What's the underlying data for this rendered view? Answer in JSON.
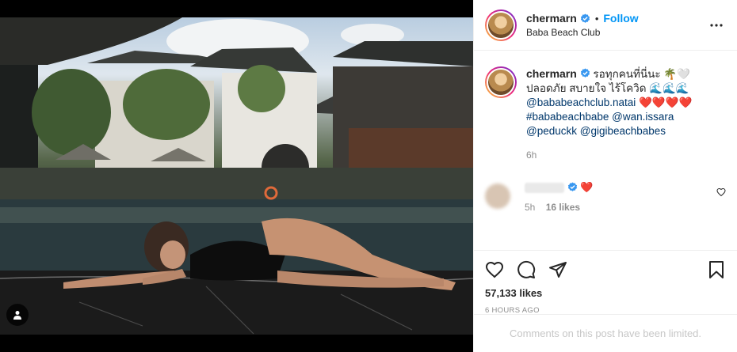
{
  "post": {
    "username": "chermarn",
    "follow_label": "Follow",
    "dot": "•",
    "location": "Baba Beach Club",
    "caption_line1": "รอทุกคนที่นี่นะ 🌴🤍",
    "caption_line2": "ปลอดภัย สบายใจ ไร้โควิด 🌊🌊🌊",
    "mention1": "@bababeachclub.natai",
    "hearts": "❤️❤️❤️❤️",
    "hashtag": "#bababeachbabe",
    "mention2": "@wan.issara",
    "mention3": "@peduckk",
    "mention4": "@gigibeachbabes",
    "caption_time": "6h"
  },
  "comment": {
    "text": "❤️",
    "time": "5h",
    "likes": "16 likes"
  },
  "stats": {
    "likes": "57,133 likes",
    "ago": "6 HOURS AGO"
  },
  "footer": {
    "limited": "Comments on this post have been limited."
  },
  "icons": [
    "verified-badge-icon",
    "more-options-icon",
    "user-tag-icon",
    "heart-icon",
    "comment-icon",
    "share-icon",
    "bookmark-icon"
  ],
  "colors": {
    "follow": "#0095f6",
    "verified": "#3897f0",
    "link": "#00376b",
    "heart": "#ed4956"
  }
}
